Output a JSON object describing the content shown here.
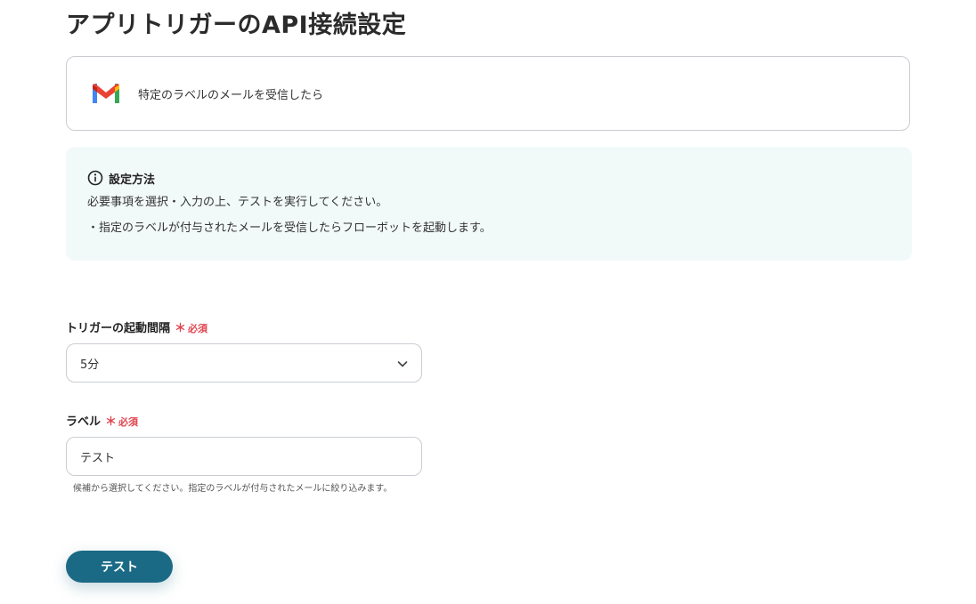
{
  "page": {
    "title": "アプリトリガーのAPI接続設定"
  },
  "app_card": {
    "icon": "gmail-icon",
    "label": "特定のラベルのメールを受信したら"
  },
  "info": {
    "icon": "info-circle-icon",
    "title": "設定方法",
    "lines": [
      "必要事項を選択・入力の上、テストを実行してください。",
      "・指定のラベルが付与されたメールを受信したらフローボットを起動します。"
    ]
  },
  "fields": {
    "interval": {
      "label": "トリガーの起動間隔",
      "required_mark": "＊",
      "required_text": "必須",
      "value": "5分"
    },
    "label_field": {
      "label": "ラベル",
      "required_mark": "＊",
      "required_text": "必須",
      "value": "テスト",
      "hint": "候補から選択してください。指定のラベルが付与されたメールに絞り込みます。"
    }
  },
  "actions": {
    "test_label": "テスト"
  },
  "colors": {
    "accent": "#1b6a85",
    "required": "#e0454f",
    "info_bg": "#f2f9f9",
    "border": "#c9cdd2"
  }
}
